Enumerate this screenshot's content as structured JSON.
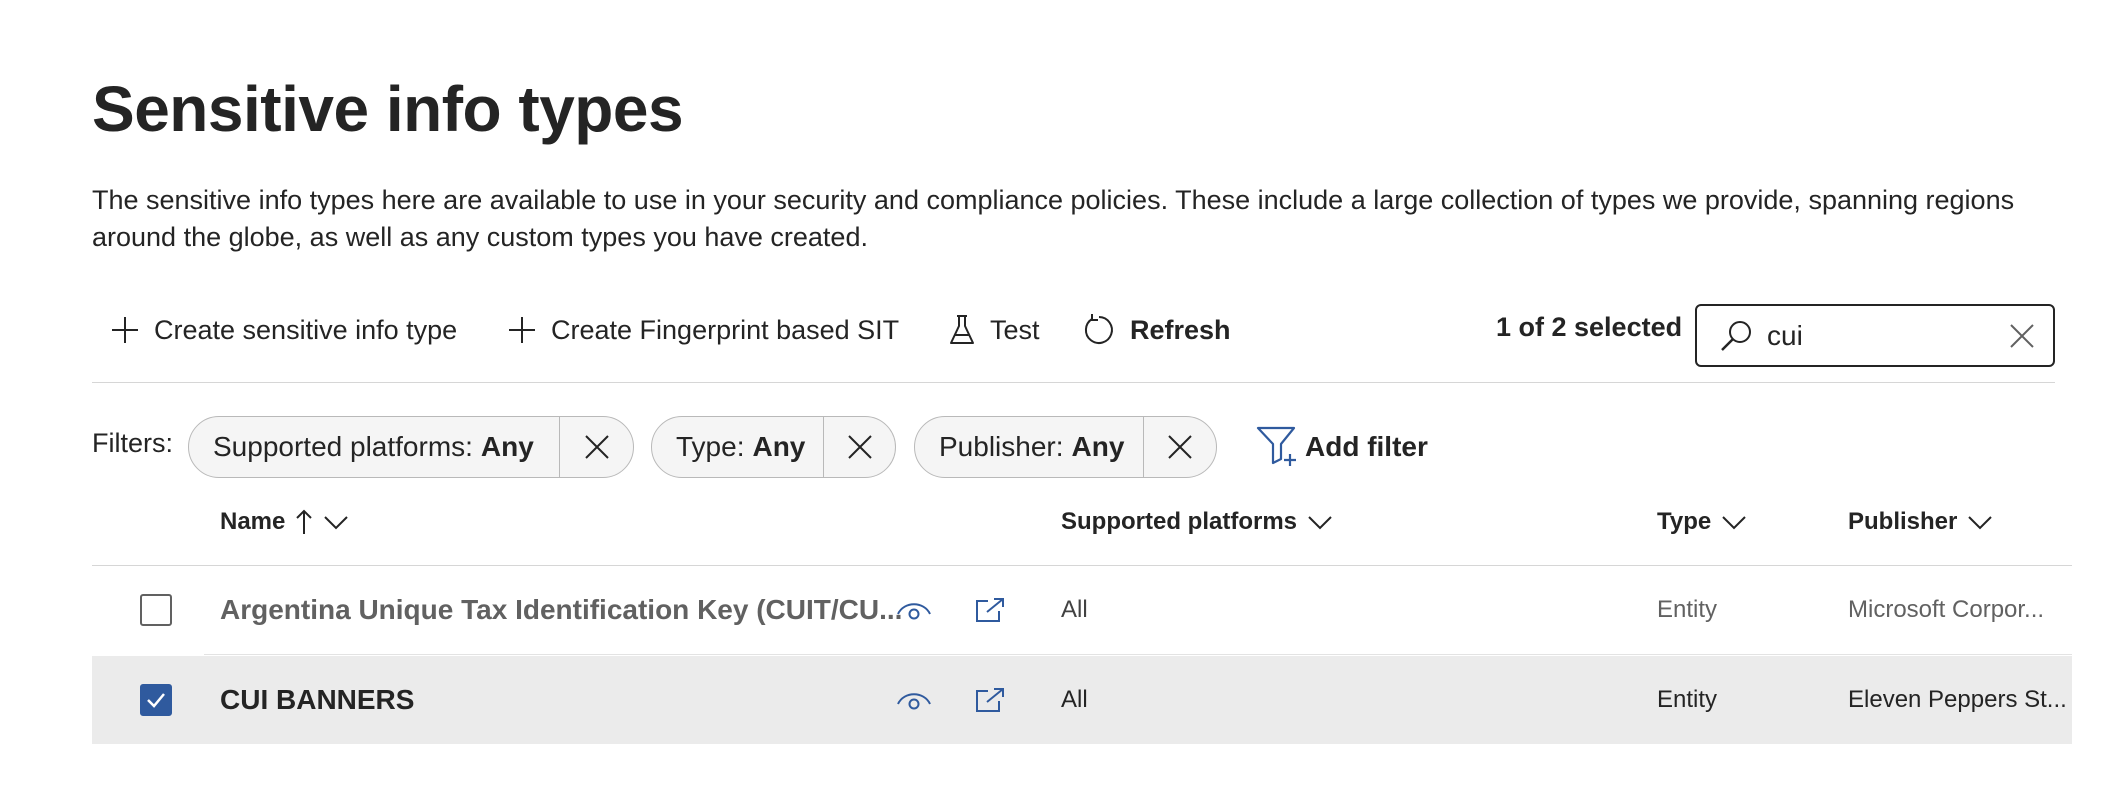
{
  "page": {
    "title": "Sensitive info types",
    "description": "The sensitive info types here are available to use in your security and compliance policies. These include a large collection of types we provide, spanning regions around the globe, as well as any custom types you have created."
  },
  "toolbar": {
    "create_label": "Create sensitive info type",
    "create_fingerprint_label": "Create Fingerprint based SIT",
    "test_label": "Test",
    "refresh_label": "Refresh",
    "selected_count": "1 of 2 selected",
    "search_value": "cui",
    "icons": [
      "plus-icon",
      "plus-icon",
      "flask-icon",
      "refresh-icon",
      "search-icon",
      "close-icon"
    ]
  },
  "filters": {
    "label": "Filters:",
    "pills": [
      {
        "name": "Supported platforms:",
        "value": "Any"
      },
      {
        "name": "Type:",
        "value": "Any"
      },
      {
        "name": "Publisher:",
        "value": "Any"
      }
    ],
    "add_filter_label": "Add filter"
  },
  "table": {
    "columns": {
      "name": "Name",
      "platforms": "Supported platforms",
      "type": "Type",
      "publisher": "Publisher"
    },
    "sort": {
      "column": "name",
      "direction": "ascending"
    },
    "rows": [
      {
        "name": "Argentina Unique Tax Identification Key (CUIT/CU...",
        "platforms": "All",
        "type": "Entity",
        "publisher": "Microsoft Corpor...",
        "selected": false
      },
      {
        "name": "CUI BANNERS",
        "platforms": "All",
        "type": "Entity",
        "publisher": "Eleven Peppers St...",
        "selected": true
      }
    ]
  },
  "colors": {
    "accent": "#2f5a9e",
    "selected_row_bg": "#ebebeb"
  }
}
